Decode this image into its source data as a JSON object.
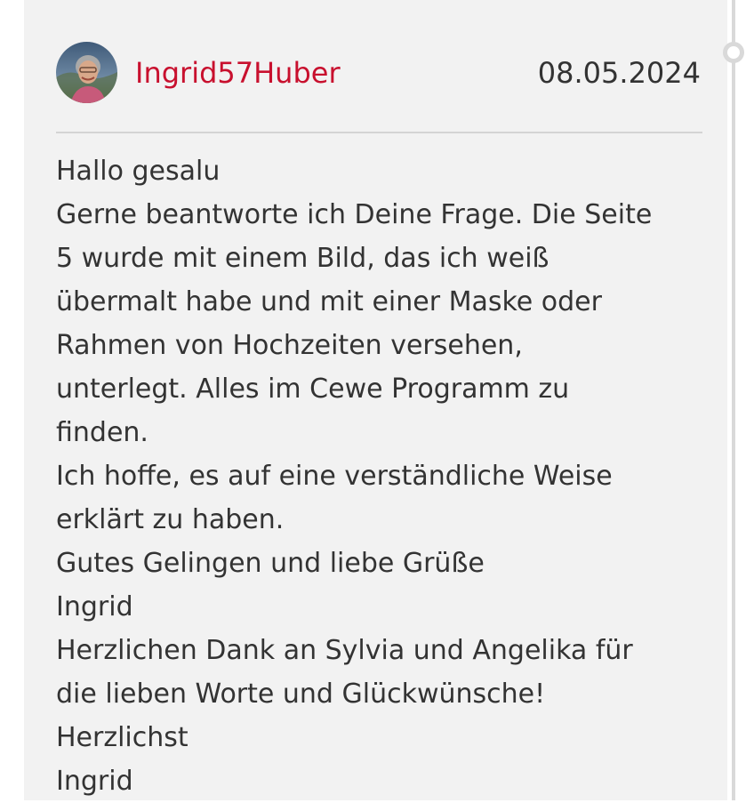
{
  "post": {
    "author": "Ingrid57Huber",
    "date": "08.05.2024",
    "lines": [
      "Hallo gesalu",
      "Gerne beantworte ich Deine Frage. Die Seite",
      "5 wurde mit einem Bild, das ich weiß",
      "übermalt habe und mit einer Maske oder",
      "Rahmen von Hochzeiten versehen,",
      "unterlegt. Alles im Cewe Programm zu",
      "finden.",
      "Ich hoffe, es auf eine verständliche Weise",
      "erklärt zu haben.",
      "Gutes Gelingen und liebe Grüße",
      "Ingrid",
      "Herzlichen Dank an Sylvia und Angelika für",
      "die lieben Worte und Glückwünsche!",
      "Herzlichst",
      "Ingrid"
    ]
  },
  "colors": {
    "author_link": "#c8102e",
    "card_background": "#f2f2f2",
    "text": "#333333"
  },
  "icons": {
    "timeline_marker": "timeline-dot-icon",
    "avatar": "user-avatar-photo"
  }
}
